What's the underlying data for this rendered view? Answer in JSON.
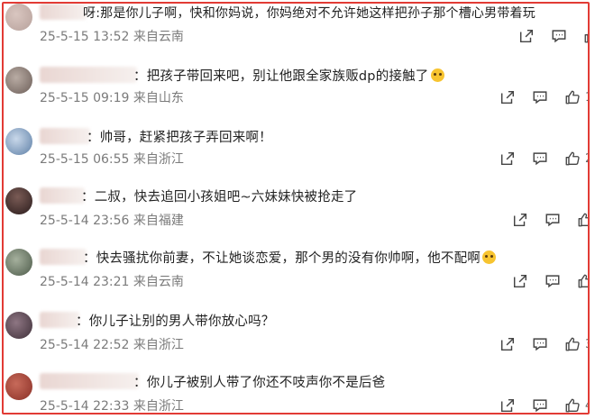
{
  "comments": [
    {
      "text": "呀:那是你儿子啊，快和你妈说，你妈绝对不允许她这样把孙子那个槽心男带着玩",
      "time": "25-5-15 13:52",
      "location": "来自云南",
      "likes": "",
      "avatar_color": "#b7a19b",
      "emoji": ""
    },
    {
      "text": "：把孩子带回来吧，别让他跟全家族贩dp的接触了",
      "time": "25-5-15 09:19",
      "location": "来自山东",
      "likes": "1",
      "avatar_color": "#8a7a72",
      "emoji": "crying-laughing-emoji"
    },
    {
      "text": "：帅哥，赶紧把孩子弄回来啊！",
      "time": "25-5-15 06:55",
      "location": "来自浙江",
      "likes": "2",
      "avatar_color": "#6e8fb0",
      "emoji": ""
    },
    {
      "text": "：二叔，快去追回小孩姐吧~六妹妹快被抢走了",
      "time": "25-5-14 23:56",
      "location": "来自福建",
      "likes": "",
      "avatar_color": "#3a2a2a",
      "emoji": ""
    },
    {
      "text": "：快去骚扰你前妻，不让她谈恋爱，那个男的没有你帅啊，他不配啊",
      "time": "25-5-14 23:21",
      "location": "来自云南",
      "likes": "",
      "avatar_color": "#5c6a58",
      "emoji": "crying-emoji"
    },
    {
      "text": "：你儿子让别的男人带你放心吗？",
      "time": "25-5-14 22:52",
      "location": "来自浙江",
      "likes": "3",
      "avatar_color": "#4b3a44",
      "emoji": ""
    },
    {
      "text": "：你儿子被别人带了你还不吱声你不是后爸",
      "time": "25-5-14 22:33",
      "location": "来自浙江",
      "likes": "4",
      "avatar_color": "#9a3a30",
      "emoji": ""
    }
  ],
  "colors": {
    "frame": "#e23b35",
    "meta": "#7b7b7b",
    "text": "#222222"
  }
}
